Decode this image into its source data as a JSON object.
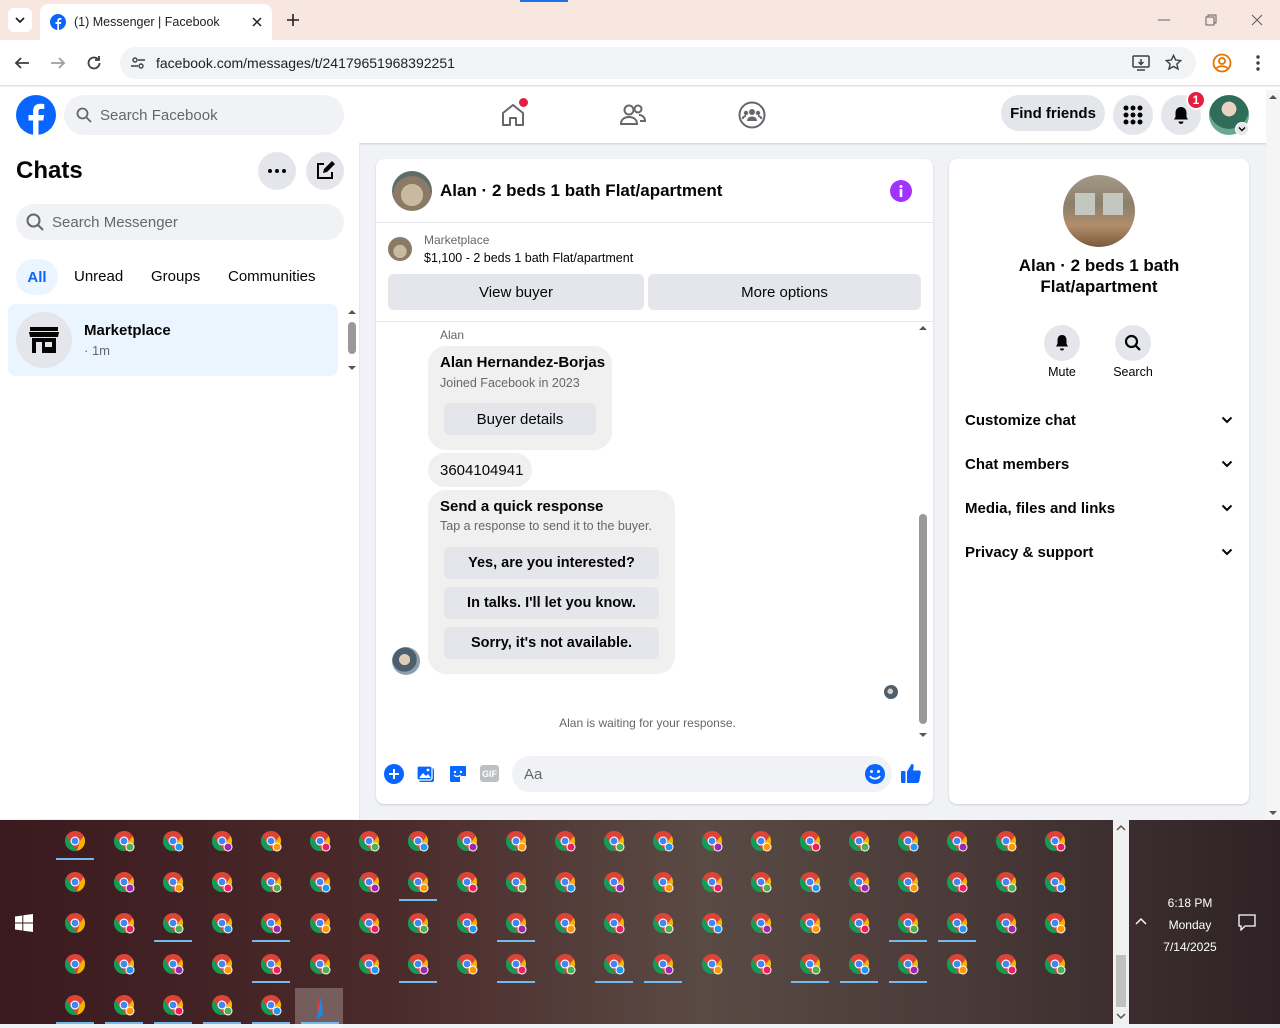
{
  "browser": {
    "tab_title": "(1) Messenger | Facebook",
    "url": "facebook.com/messages/t/24179651968392251"
  },
  "fb": {
    "search_placeholder": "Search Facebook",
    "find_friends": "Find friends",
    "notification_count": "1"
  },
  "chats": {
    "title": "Chats",
    "search_placeholder": "Search Messenger",
    "filters": [
      "All",
      "Unread",
      "Groups",
      "Communities"
    ],
    "items": [
      {
        "name": "Marketplace",
        "meta": "· 1m"
      }
    ]
  },
  "conversation": {
    "title": "Alan · 2 beds 1 bath Flat/apartment",
    "listing_source": "Marketplace",
    "listing_text": "$1,100 - 2 beds 1 bath Flat/apartment",
    "view_buyer": "View buyer",
    "more_options": "More options",
    "sender": "Alan",
    "buyer_name": "Alan Hernandez-Borjas",
    "buyer_joined": "Joined Facebook in 2023",
    "buyer_details": "Buyer details",
    "phone": "3604104941",
    "quick_title": "Send a quick response",
    "quick_sub": "Tap a response to send it to the buyer.",
    "quick_responses": [
      "Yes, are you interested?",
      "In talks. I'll let you know.",
      "Sorry, it's not available."
    ],
    "waiting": "Alan is waiting for your response.",
    "composer_placeholder": "Aa"
  },
  "details": {
    "title": "Alan · 2 beds 1 bath Flat/apartment",
    "mute": "Mute",
    "search": "Search",
    "sections": [
      "Customize chat",
      "Chat members",
      "Media, files and links",
      "Privacy & support"
    ]
  },
  "taskbar": {
    "time": "6:18 PM",
    "day": "Monday",
    "date": "7/14/2025"
  },
  "colors": {
    "fb_blue": "#0866ff",
    "messenger_purple": "#a033ff",
    "notif_red": "#e41e3f"
  }
}
